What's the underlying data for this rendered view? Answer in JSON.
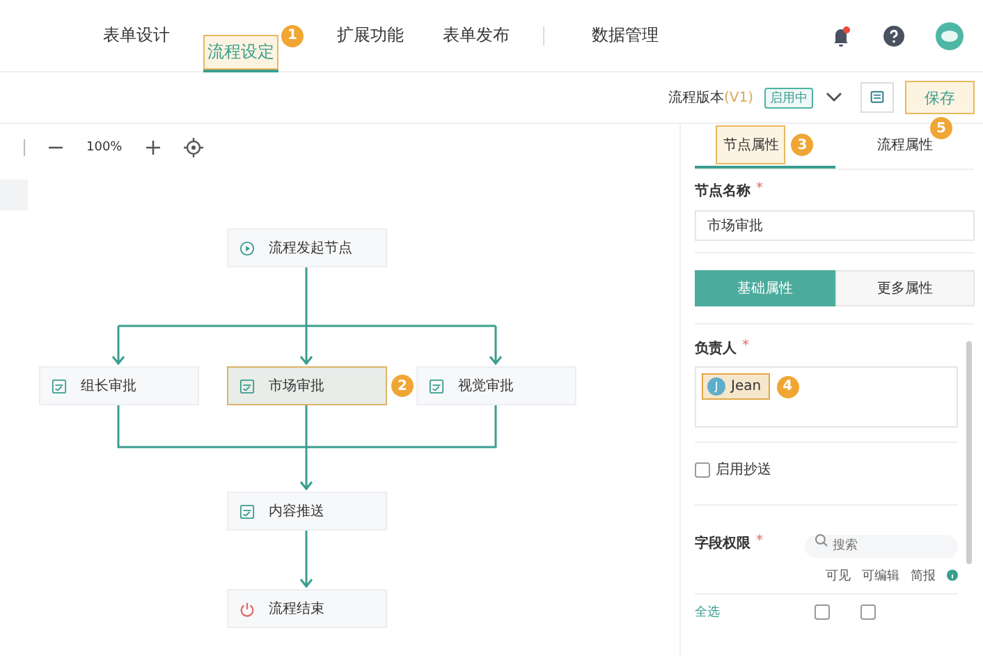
{
  "nav": {
    "tabs": [
      {
        "label": "表单设计",
        "selected": false,
        "highlighted": false
      },
      {
        "label": "流程设定",
        "selected": true,
        "highlighted": true,
        "badge": "1"
      },
      {
        "label": "扩展功能",
        "selected": false,
        "highlighted": false
      },
      {
        "label": "表单发布",
        "selected": false,
        "highlighted": false
      },
      {
        "label": "数据管理",
        "selected": false,
        "highlighted": false
      }
    ],
    "notification_dot": true
  },
  "toolbar": {
    "version_label": "流程版本",
    "version": "(V1)",
    "status": "启用中",
    "save_button": {
      "label": "保存",
      "highlighted": true,
      "badge": "5"
    }
  },
  "canvas": {
    "zoom": "100%",
    "rows": [
      [
        {
          "kind": "start",
          "label": "流程发起节点",
          "selected": false
        }
      ],
      [
        {
          "kind": "approval",
          "label": "组长审批",
          "selected": false
        },
        {
          "kind": "approval",
          "label": "市场审批",
          "selected": true,
          "badge": "2"
        },
        {
          "kind": "approval",
          "label": "视觉审批",
          "selected": false
        }
      ],
      [
        {
          "kind": "approval",
          "label": "内容推送",
          "selected": false
        }
      ],
      [
        {
          "kind": "end",
          "label": "流程结束",
          "selected": false
        }
      ]
    ]
  },
  "panel": {
    "tabs": [
      {
        "label": "节点属性",
        "selected": true,
        "highlighted": true,
        "badge": "3"
      },
      {
        "label": "流程属性",
        "selected": false,
        "highlighted": false
      }
    ],
    "node_name": {
      "label": "节点名称",
      "required_mark": "*",
      "value": "市场审批"
    },
    "segments": [
      {
        "label": "基础属性",
        "selected": true
      },
      {
        "label": "更多属性",
        "selected": false
      }
    ],
    "owner": {
      "label": "负责人",
      "required_mark": "*",
      "people": [
        {
          "initial": "J",
          "name": "Jean",
          "highlighted": true,
          "badge": "4"
        }
      ]
    },
    "cc": {
      "label": "启用抄送",
      "checked": false
    },
    "permissions": {
      "label": "字段权限",
      "required_mark": "*",
      "search_placeholder": "搜索",
      "columns": [
        "可见",
        "可编辑",
        "简报"
      ],
      "rows": [
        {
          "label": "全选",
          "visible": false,
          "editable": false
        }
      ]
    }
  }
}
